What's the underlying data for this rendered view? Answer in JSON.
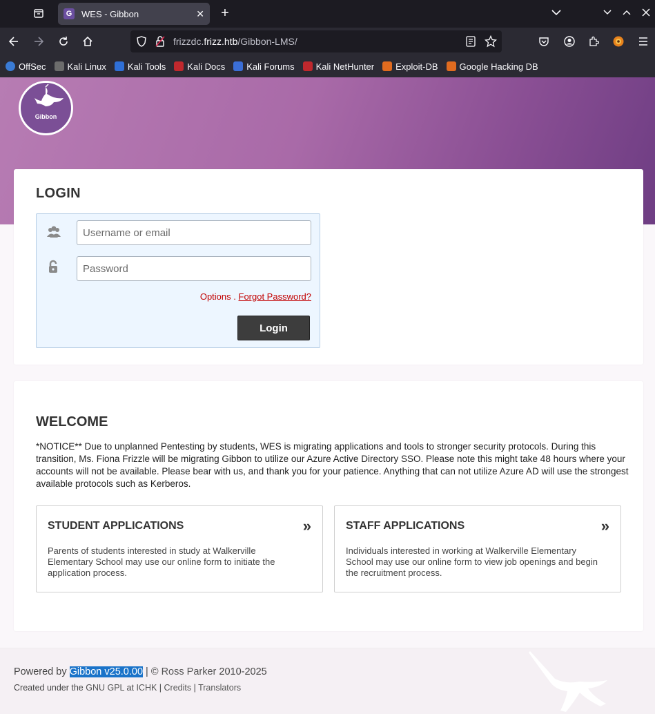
{
  "browser": {
    "tab": {
      "favicon_letter": "G",
      "title": "WES - Gibbon",
      "close": "✕"
    },
    "new_tab": "+",
    "url": {
      "prefix": "frizzdc.",
      "host": "frizz.htb",
      "path": "/Gibbon-LMS/"
    },
    "bookmarks": [
      {
        "label": "OffSec",
        "color": "#3a7bd5"
      },
      {
        "label": "Kali Linux",
        "color": "#6c6c6c"
      },
      {
        "label": "Kali Tools",
        "color": "#2f6fd6"
      },
      {
        "label": "Kali Docs",
        "color": "#c0282d"
      },
      {
        "label": "Kali Forums",
        "color": "#3b6ed6"
      },
      {
        "label": "Kali NetHunter",
        "color": "#c0282d"
      },
      {
        "label": "Exploit-DB",
        "color": "#e06b1f"
      },
      {
        "label": "Google Hacking DB",
        "color": "#e06b1f"
      }
    ]
  },
  "login": {
    "heading": "LOGIN",
    "username_placeholder": "Username or email",
    "password_placeholder": "Password",
    "options_label": "Options",
    "separator": " . ",
    "forgot_label": "Forgot Password?",
    "button_label": "Login"
  },
  "welcome": {
    "heading": "WELCOME",
    "notice": "*NOTICE** Due to unplanned Pentesting by students, WES is migrating applications and tools to stronger security protocols. During this transition, Ms. Fiona Frizzle will be migrating Gibbon to utilize our Azure Active Directory SSO. Please note this might take 48 hours where your accounts will not be available. Please bear with us, and thank you for your patience. Anything that can not utilize Azure AD will use the strongest available protocols such as Kerberos.",
    "student": {
      "title": "STUDENT APPLICATIONS",
      "desc": "Parents of students interested in study at Walkerville Elementary School may use our online form to initiate the application process.",
      "arrow": "»"
    },
    "staff": {
      "title": "STAFF APPLICATIONS",
      "desc": "Individuals interested in working at Walkerville Elementary School may use our online form to view job openings and begin the recruitment process.",
      "arrow": "»"
    }
  },
  "logo": {
    "text": "Gibbon"
  },
  "footer": {
    "powered_prefix": "Powered by ",
    "version": "Gibbon v25.0.00",
    "copyright_sep": " | © ",
    "author": "Ross Parker",
    "years": " 2010-2025",
    "created_prefix": "Created under the ",
    "license": "GNU GPL",
    "at": " at ",
    "ichk": "ICHK",
    "sep": " | ",
    "credits": "Credits",
    "translators": "Translators"
  }
}
